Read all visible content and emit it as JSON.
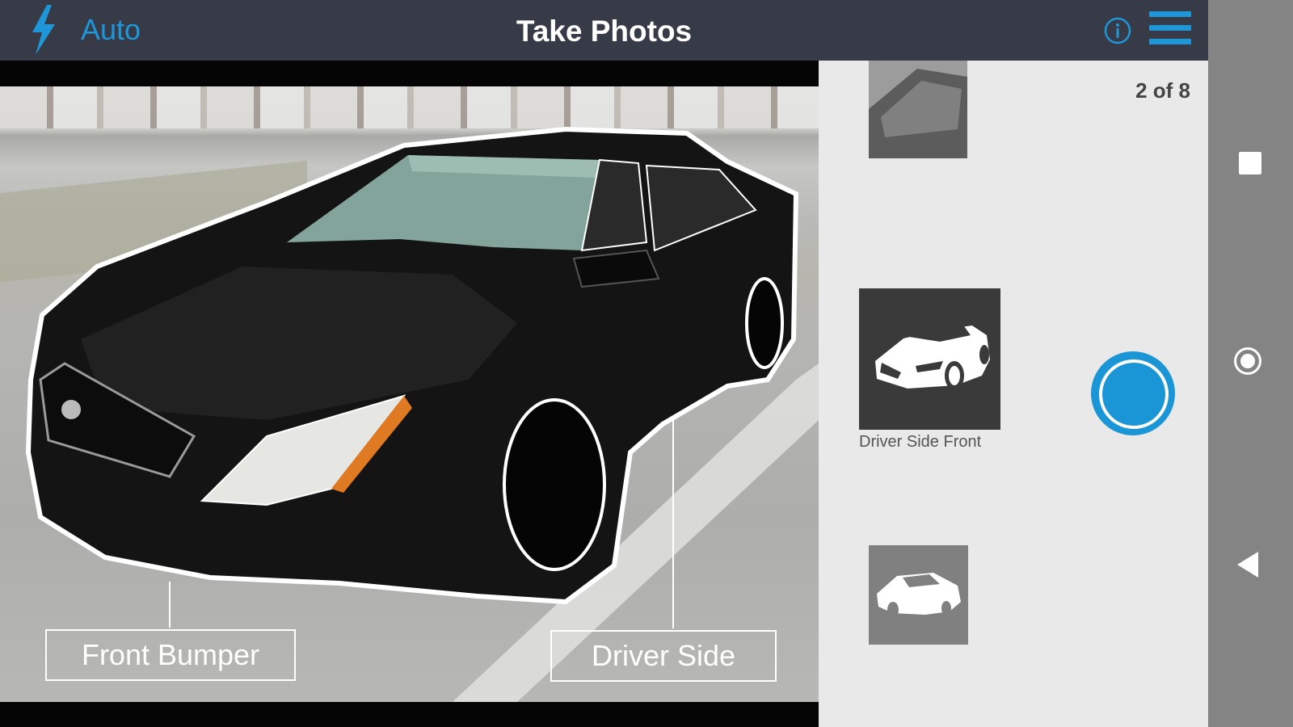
{
  "header": {
    "flash_mode_label": "Auto",
    "title": "Take Photos",
    "accent_color": "#1e96d8",
    "bar_color": "#373b47"
  },
  "icons": {
    "flash": "lightning-bolt-icon",
    "info": "info-circle-icon",
    "menu": "hamburger-menu-icon"
  },
  "viewfinder": {
    "labels": {
      "front": "Front Bumper",
      "driver": "Driver Side"
    }
  },
  "side_panel": {
    "counter": "2 of 8",
    "current_shot_caption": "Driver Side Front",
    "shutter_color": "#1a96d6"
  },
  "system_nav": {
    "buttons": [
      "recents-square-icon",
      "home-circle-icon",
      "back-triangle-icon"
    ]
  }
}
